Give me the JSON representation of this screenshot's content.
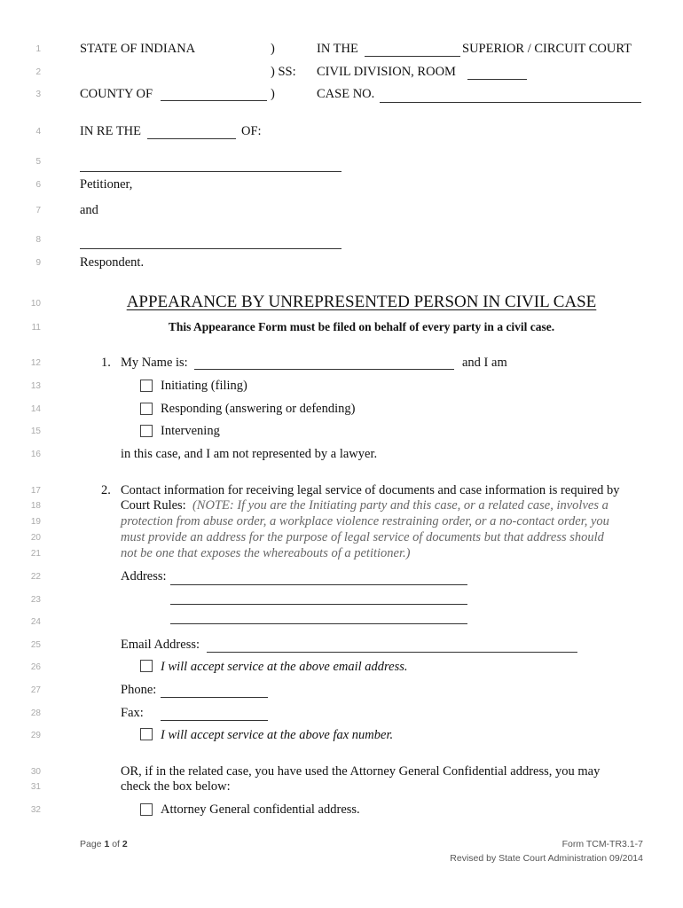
{
  "line_numbers": [
    "1",
    "2",
    "3",
    "4",
    "5",
    "6",
    "7",
    "8",
    "9",
    "10",
    "11",
    "12",
    "13",
    "14",
    "15",
    "16",
    "17",
    "18",
    "19",
    "20",
    "21",
    "22",
    "23",
    "24",
    "25",
    "26",
    "27",
    "28",
    "29",
    "30",
    "31",
    "32"
  ],
  "caption": {
    "state": "STATE OF INDIANA",
    "paren": ")",
    "ss": ") SS:",
    "county": "COUNTY OF",
    "in_the": "IN THE",
    "court": "SUPERIOR / CIRCUIT COURT",
    "civil_division": "CIVIL DIVISION, ROOM",
    "case_no": "CASE NO.",
    "in_re_the": "IN RE THE",
    "of": "OF:",
    "petitioner": "Petitioner,",
    "and": "and",
    "respondent": "Respondent."
  },
  "title": "APPEARANCE BY UNREPRESENTED PERSON IN CIVIL CASE",
  "subtitle": "This Appearance Form must be filed on behalf of every party in a civil case.",
  "section1": {
    "number": "1.",
    "name_label": "My Name is:",
    "and_i_am": "and I am",
    "options": [
      "Initiating (filing)",
      "Responding (answering or defending)",
      "Intervening"
    ],
    "options_checked": [
      false,
      false,
      false
    ],
    "closing": "in this case, and I am not represented by a lawyer."
  },
  "section2": {
    "number": "2.",
    "intro_line1": "Contact information for receiving legal service of documents and case information is required by",
    "intro_line2": "Court Rules:",
    "note_lines": [
      "(NOTE: If you are the Initiating party and this case, or a related case, involves a",
      "protection from abuse order, a workplace violence restraining order, or a no-contact order, you",
      "must provide an address for the purpose of legal service of documents but that address should",
      "not be one that exposes the whereabouts of a petitioner.)"
    ],
    "address_label": "Address:",
    "email_label": "Email Address:",
    "email_accept": "I will accept service at the above email address.",
    "phone_label": "Phone:",
    "fax_label": "Fax:",
    "fax_accept": "I will accept service at the above fax number.",
    "or_line1": "OR, if in the related case, you have used the Attorney General Confidential address, you may",
    "or_line2": "check the box below:",
    "ag_option": "Attorney General confidential address."
  },
  "footer": {
    "page_prefix": "Page",
    "page_current": "1",
    "page_of": "of",
    "page_total": "2",
    "form_id": "Form TCM-TR3.1-7",
    "revised": "Revised by State Court Administration 09/2014"
  }
}
